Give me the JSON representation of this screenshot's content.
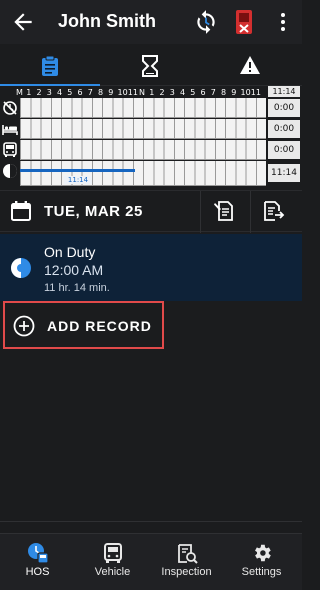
{
  "header": {
    "title": "John Smith"
  },
  "tabs": [
    "logs",
    "hourglass",
    "warning"
  ],
  "log_grid": {
    "hour_labels": [
      "M",
      "1",
      "2",
      "3",
      "4",
      "5",
      "6",
      "7",
      "8",
      "9",
      "10",
      "11",
      "N",
      "1",
      "2",
      "3",
      "4",
      "5",
      "6",
      "7",
      "8",
      "9",
      "10",
      "11"
    ],
    "header_total": "11:14",
    "rows": [
      {
        "status": "off-duty",
        "total": "0:00"
      },
      {
        "status": "sleeper-berth",
        "total": "0:00"
      },
      {
        "status": "driving",
        "total": "0:00"
      },
      {
        "status": "on-duty",
        "total": "11:14"
      }
    ],
    "current_time": "11:14",
    "on_duty_fraction": 0.468
  },
  "date_bar": {
    "date": "TUE, MAR 25"
  },
  "record": {
    "status": "On Duty",
    "time": "12:00 AM",
    "duration": "11 hr. 14 min."
  },
  "add_record": {
    "label": "ADD RECORD"
  },
  "bottom_nav": [
    {
      "label": "HOS",
      "icon": "hos-icon",
      "active": true
    },
    {
      "label": "Vehicle",
      "icon": "vehicle-icon",
      "active": false
    },
    {
      "label": "Inspection",
      "icon": "inspection-icon",
      "active": false
    },
    {
      "label": "Settings",
      "icon": "settings-icon",
      "active": false
    }
  ],
  "colors": {
    "accent": "#2f8be6",
    "on_duty": "#1565c0",
    "alert": "#e53935",
    "highlight_border": "#e14a4a"
  }
}
